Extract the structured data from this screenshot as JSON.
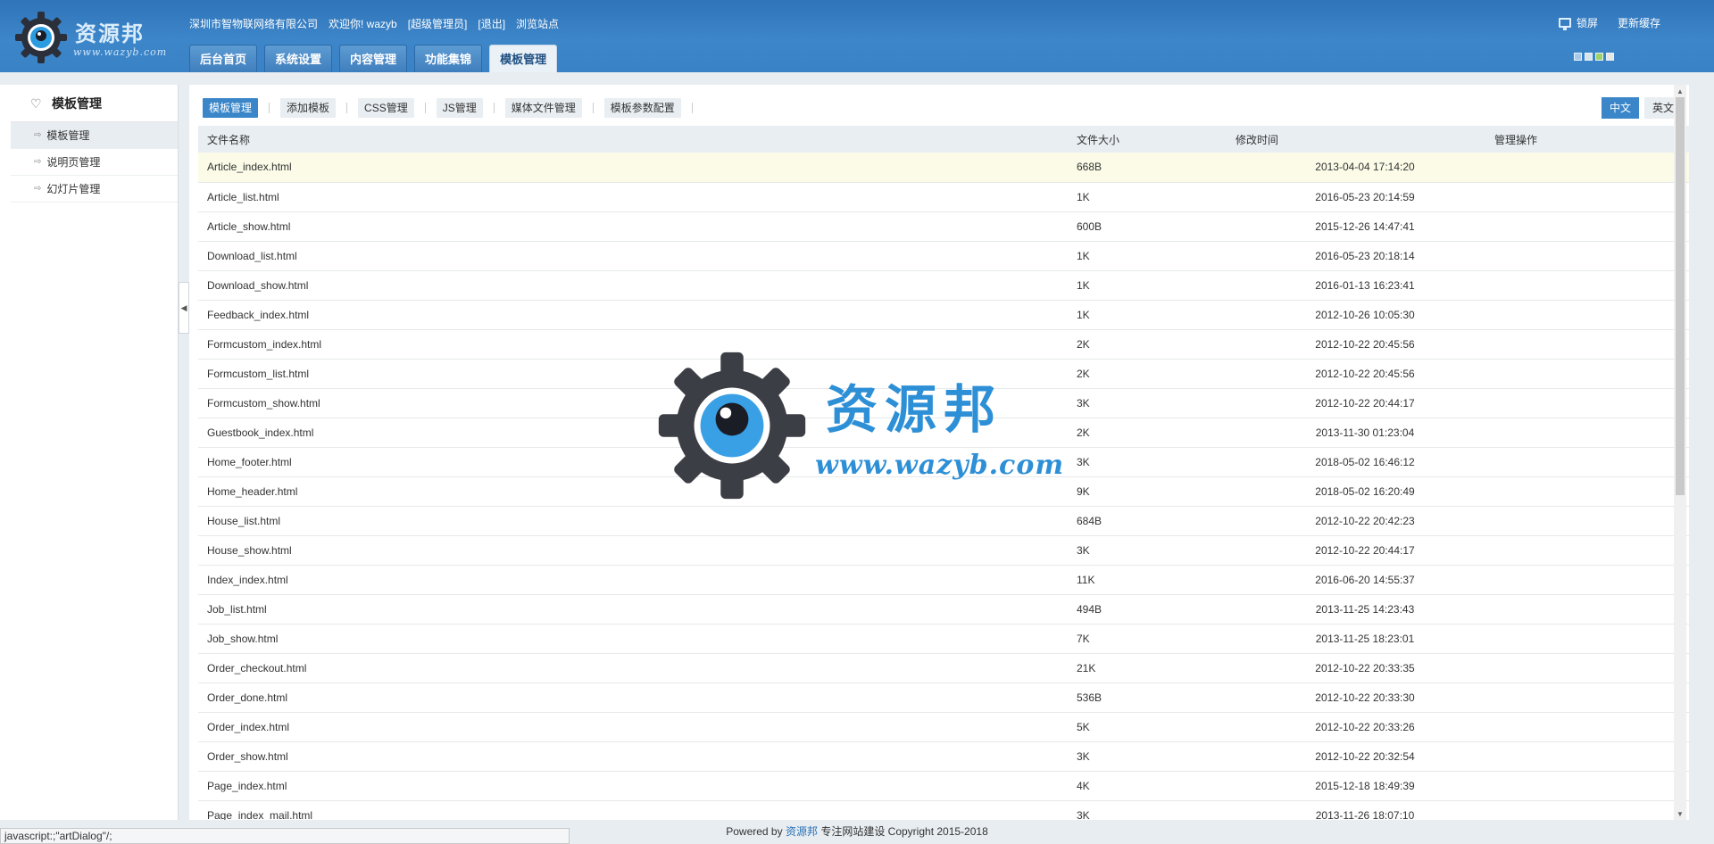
{
  "header": {
    "logo_text": "资源邦",
    "logo_url": "www.wazyb.com",
    "company": "深圳市智物联网络有限公司",
    "welcome": "欢迎你! wazyb",
    "role": "[超级管理员]",
    "logout": "[退出]",
    "browse": "浏览站点",
    "lock_screen": "锁屏",
    "refresh_cache": "更新缓存",
    "tabs": [
      {
        "label": "后台首页"
      },
      {
        "label": "系统设置"
      },
      {
        "label": "内容管理"
      },
      {
        "label": "功能集锦"
      },
      {
        "label": "模板管理"
      }
    ],
    "skin_colors": [
      "#a9c9e8",
      "#d8e3ea",
      "#9fd36a",
      "#e6e6e6"
    ]
  },
  "sidebar": {
    "title": "模板管理",
    "items": [
      {
        "label": "模板管理"
      },
      {
        "label": "说明页管理"
      },
      {
        "label": "幻灯片管理"
      }
    ]
  },
  "subnav": {
    "items": [
      {
        "label": "模板管理"
      },
      {
        "label": "添加模板"
      },
      {
        "label": "CSS管理"
      },
      {
        "label": "JS管理"
      },
      {
        "label": "媒体文件管理"
      },
      {
        "label": "模板参数配置"
      }
    ],
    "lang_zh": "中文",
    "lang_en": "英文"
  },
  "table": {
    "headers": {
      "name": "文件名称",
      "size": "文件大小",
      "time": "修改时间",
      "ops": "管理操作"
    },
    "rows": [
      {
        "name": "Article_index.html",
        "size": "668B",
        "time": "2013-04-04 17:14:20"
      },
      {
        "name": "Article_list.html",
        "size": "1K",
        "time": "2016-05-23 20:14:59"
      },
      {
        "name": "Article_show.html",
        "size": "600B",
        "time": "2015-12-26 14:47:41"
      },
      {
        "name": "Download_list.html",
        "size": "1K",
        "time": "2016-05-23 20:18:14"
      },
      {
        "name": "Download_show.html",
        "size": "1K",
        "time": "2016-01-13 16:23:41"
      },
      {
        "name": "Feedback_index.html",
        "size": "1K",
        "time": "2012-10-26 10:05:30"
      },
      {
        "name": "Formcustom_index.html",
        "size": "2K",
        "time": "2012-10-22 20:45:56"
      },
      {
        "name": "Formcustom_list.html",
        "size": "2K",
        "time": "2012-10-22 20:45:56"
      },
      {
        "name": "Formcustom_show.html",
        "size": "3K",
        "time": "2012-10-22 20:44:17"
      },
      {
        "name": "Guestbook_index.html",
        "size": "2K",
        "time": "2013-11-30 01:23:04"
      },
      {
        "name": "Home_footer.html",
        "size": "3K",
        "time": "2018-05-02 16:46:12"
      },
      {
        "name": "Home_header.html",
        "size": "9K",
        "time": "2018-05-02 16:20:49"
      },
      {
        "name": "House_list.html",
        "size": "684B",
        "time": "2012-10-22 20:42:23"
      },
      {
        "name": "House_show.html",
        "size": "3K",
        "time": "2012-10-22 20:44:17"
      },
      {
        "name": "Index_index.html",
        "size": "11K",
        "time": "2016-06-20 14:55:37"
      },
      {
        "name": "Job_list.html",
        "size": "494B",
        "time": "2013-11-25 14:23:43"
      },
      {
        "name": "Job_show.html",
        "size": "7K",
        "time": "2013-11-25 18:23:01"
      },
      {
        "name": "Order_checkout.html",
        "size": "21K",
        "time": "2012-10-22 20:33:35"
      },
      {
        "name": "Order_done.html",
        "size": "536B",
        "time": "2012-10-22 20:33:30"
      },
      {
        "name": "Order_index.html",
        "size": "5K",
        "time": "2012-10-22 20:33:26"
      },
      {
        "name": "Order_show.html",
        "size": "3K",
        "time": "2012-10-22 20:32:54"
      },
      {
        "name": "Page_index.html",
        "size": "4K",
        "time": "2015-12-18 18:49:39"
      },
      {
        "name": "Page_index_mail.html",
        "size": "3K",
        "time": "2013-11-26 18:07:10"
      }
    ]
  },
  "footer": {
    "powered": "Powered by",
    "brand": "资源邦",
    "slogan": "专注网站建设",
    "copyright": "Copyright 2015-2018"
  },
  "status_bar": "javascript:;\"artDialog\"/;",
  "watermark": {
    "text": "资源邦",
    "url": "www.wazyb.com"
  }
}
